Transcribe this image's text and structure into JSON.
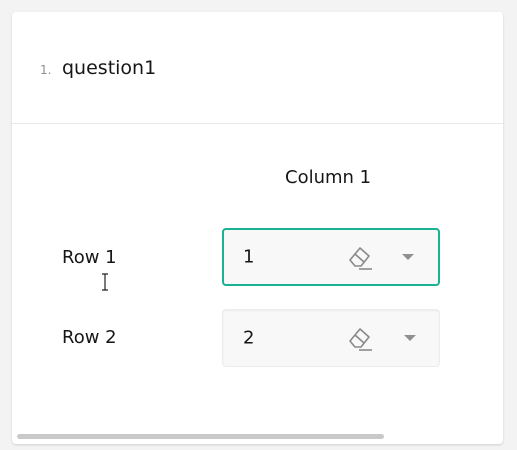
{
  "question": {
    "number": "1.",
    "title": "question1"
  },
  "matrix": {
    "column_header": "Column 1",
    "rows": [
      {
        "label": "Row 1",
        "value": "1",
        "focused": true
      },
      {
        "label": "Row 2",
        "value": "2",
        "focused": false
      }
    ]
  },
  "icons": {
    "clear": "eraser-icon",
    "dropdown": "chevron-down-icon",
    "cursor": "text-cursor-icon"
  },
  "colors": {
    "accent": "#19b394",
    "background": "#f3f3f3",
    "input_background": "#f8f8f8",
    "text": "#161616",
    "muted": "#909090"
  }
}
